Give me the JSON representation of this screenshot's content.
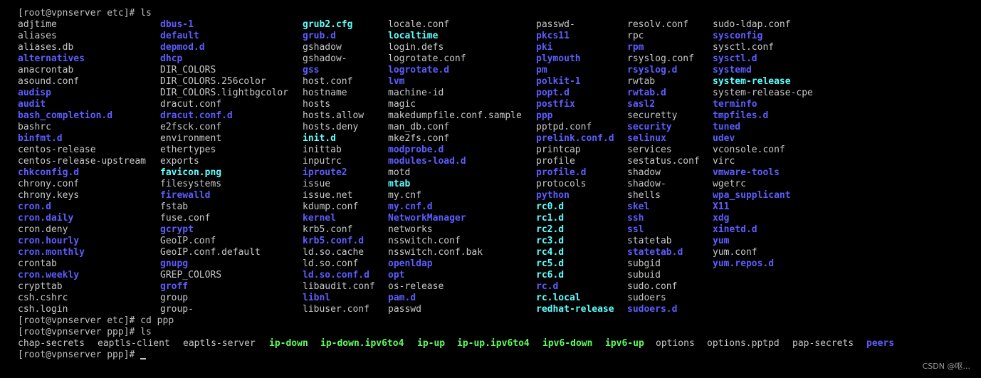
{
  "prompts": {
    "p1": "[root@vpnserver etc]# ls",
    "p2": "[root@vpnserver etc]# cd ppp",
    "p3": "[root@vpnserver ppp]# ls",
    "p4": "[root@vpnserver ppp]# "
  },
  "colors": {
    "background": "#000000",
    "file": "#c8c8c8",
    "directory": "#5d5dff",
    "symlink": "#5dffff",
    "executable": "#5dff5d"
  },
  "etc_listing": [
    [
      {
        "name": "adjtime",
        "type": "file"
      },
      {
        "name": "aliases",
        "type": "file"
      },
      {
        "name": "aliases.db",
        "type": "file"
      },
      {
        "name": "alternatives",
        "type": "dir"
      },
      {
        "name": "anacrontab",
        "type": "file"
      },
      {
        "name": "asound.conf",
        "type": "file"
      },
      {
        "name": "audisp",
        "type": "dir"
      },
      {
        "name": "audit",
        "type": "dir"
      },
      {
        "name": "bash_completion.d",
        "type": "dir"
      },
      {
        "name": "bashrc",
        "type": "file"
      },
      {
        "name": "binfmt.d",
        "type": "dir"
      },
      {
        "name": "centos-release",
        "type": "file"
      },
      {
        "name": "centos-release-upstream",
        "type": "file"
      },
      {
        "name": "chkconfig.d",
        "type": "dir"
      },
      {
        "name": "chrony.conf",
        "type": "file"
      },
      {
        "name": "chrony.keys",
        "type": "file"
      },
      {
        "name": "cron.d",
        "type": "dir"
      },
      {
        "name": "cron.daily",
        "type": "dir"
      },
      {
        "name": "cron.deny",
        "type": "file"
      },
      {
        "name": "cron.hourly",
        "type": "dir"
      },
      {
        "name": "cron.monthly",
        "type": "dir"
      },
      {
        "name": "crontab",
        "type": "file"
      },
      {
        "name": "cron.weekly",
        "type": "dir"
      },
      {
        "name": "crypttab",
        "type": "file"
      },
      {
        "name": "csh.cshrc",
        "type": "file"
      },
      {
        "name": "csh.login",
        "type": "file"
      }
    ],
    [
      {
        "name": "dbus-1",
        "type": "dir"
      },
      {
        "name": "default",
        "type": "dir"
      },
      {
        "name": "depmod.d",
        "type": "dir"
      },
      {
        "name": "dhcp",
        "type": "dir"
      },
      {
        "name": "DIR_COLORS",
        "type": "file"
      },
      {
        "name": "DIR_COLORS.256color",
        "type": "file"
      },
      {
        "name": "DIR_COLORS.lightbgcolor",
        "type": "file"
      },
      {
        "name": "dracut.conf",
        "type": "file"
      },
      {
        "name": "dracut.conf.d",
        "type": "dir"
      },
      {
        "name": "e2fsck.conf",
        "type": "file"
      },
      {
        "name": "environment",
        "type": "file"
      },
      {
        "name": "ethertypes",
        "type": "file"
      },
      {
        "name": "exports",
        "type": "file"
      },
      {
        "name": "favicon.png",
        "type": "link"
      },
      {
        "name": "filesystems",
        "type": "file"
      },
      {
        "name": "firewalld",
        "type": "dir"
      },
      {
        "name": "fstab",
        "type": "file"
      },
      {
        "name": "fuse.conf",
        "type": "file"
      },
      {
        "name": "gcrypt",
        "type": "dir"
      },
      {
        "name": "GeoIP.conf",
        "type": "file"
      },
      {
        "name": "GeoIP.conf.default",
        "type": "file"
      },
      {
        "name": "gnupg",
        "type": "dir"
      },
      {
        "name": "GREP_COLORS",
        "type": "file"
      },
      {
        "name": "groff",
        "type": "dir"
      },
      {
        "name": "group",
        "type": "file"
      },
      {
        "name": "group-",
        "type": "file"
      }
    ],
    [
      {
        "name": "grub2.cfg",
        "type": "link"
      },
      {
        "name": "grub.d",
        "type": "dir"
      },
      {
        "name": "gshadow",
        "type": "file"
      },
      {
        "name": "gshadow-",
        "type": "file"
      },
      {
        "name": "gss",
        "type": "dir"
      },
      {
        "name": "host.conf",
        "type": "file"
      },
      {
        "name": "hostname",
        "type": "file"
      },
      {
        "name": "hosts",
        "type": "file"
      },
      {
        "name": "hosts.allow",
        "type": "file"
      },
      {
        "name": "hosts.deny",
        "type": "file"
      },
      {
        "name": "init.d",
        "type": "link"
      },
      {
        "name": "inittab",
        "type": "file"
      },
      {
        "name": "inputrc",
        "type": "file"
      },
      {
        "name": "iproute2",
        "type": "dir"
      },
      {
        "name": "issue",
        "type": "file"
      },
      {
        "name": "issue.net",
        "type": "file"
      },
      {
        "name": "kdump.conf",
        "type": "file"
      },
      {
        "name": "kernel",
        "type": "dir"
      },
      {
        "name": "krb5.conf",
        "type": "file"
      },
      {
        "name": "krb5.conf.d",
        "type": "dir"
      },
      {
        "name": "ld.so.cache",
        "type": "file"
      },
      {
        "name": "ld.so.conf",
        "type": "file"
      },
      {
        "name": "ld.so.conf.d",
        "type": "dir"
      },
      {
        "name": "libaudit.conf",
        "type": "file"
      },
      {
        "name": "libnl",
        "type": "dir"
      },
      {
        "name": "libuser.conf",
        "type": "file"
      }
    ],
    [
      {
        "name": "locale.conf",
        "type": "file"
      },
      {
        "name": "localtime",
        "type": "link"
      },
      {
        "name": "login.defs",
        "type": "file"
      },
      {
        "name": "logrotate.conf",
        "type": "file"
      },
      {
        "name": "logrotate.d",
        "type": "dir"
      },
      {
        "name": "lvm",
        "type": "dir"
      },
      {
        "name": "machine-id",
        "type": "file"
      },
      {
        "name": "magic",
        "type": "file"
      },
      {
        "name": "makedumpfile.conf.sample",
        "type": "file"
      },
      {
        "name": "man_db.conf",
        "type": "file"
      },
      {
        "name": "mke2fs.conf",
        "type": "file"
      },
      {
        "name": "modprobe.d",
        "type": "dir"
      },
      {
        "name": "modules-load.d",
        "type": "dir"
      },
      {
        "name": "motd",
        "type": "file"
      },
      {
        "name": "mtab",
        "type": "link"
      },
      {
        "name": "my.cnf",
        "type": "file"
      },
      {
        "name": "my.cnf.d",
        "type": "dir"
      },
      {
        "name": "NetworkManager",
        "type": "dir"
      },
      {
        "name": "networks",
        "type": "file"
      },
      {
        "name": "nsswitch.conf",
        "type": "file"
      },
      {
        "name": "nsswitch.conf.bak",
        "type": "file"
      },
      {
        "name": "openldap",
        "type": "dir"
      },
      {
        "name": "opt",
        "type": "dir"
      },
      {
        "name": "os-release",
        "type": "file"
      },
      {
        "name": "pam.d",
        "type": "dir"
      },
      {
        "name": "passwd",
        "type": "file"
      }
    ],
    [
      {
        "name": "passwd-",
        "type": "file"
      },
      {
        "name": "pkcs11",
        "type": "dir"
      },
      {
        "name": "pki",
        "type": "dir"
      },
      {
        "name": "plymouth",
        "type": "dir"
      },
      {
        "name": "pm",
        "type": "dir"
      },
      {
        "name": "polkit-1",
        "type": "dir"
      },
      {
        "name": "popt.d",
        "type": "dir"
      },
      {
        "name": "postfix",
        "type": "dir"
      },
      {
        "name": "ppp",
        "type": "dir"
      },
      {
        "name": "pptpd.conf",
        "type": "file"
      },
      {
        "name": "prelink.conf.d",
        "type": "dir"
      },
      {
        "name": "printcap",
        "type": "file"
      },
      {
        "name": "profile",
        "type": "file"
      },
      {
        "name": "profile.d",
        "type": "dir"
      },
      {
        "name": "protocols",
        "type": "file"
      },
      {
        "name": "python",
        "type": "dir"
      },
      {
        "name": "rc0.d",
        "type": "link"
      },
      {
        "name": "rc1.d",
        "type": "link"
      },
      {
        "name": "rc2.d",
        "type": "link"
      },
      {
        "name": "rc3.d",
        "type": "link"
      },
      {
        "name": "rc4.d",
        "type": "link"
      },
      {
        "name": "rc5.d",
        "type": "link"
      },
      {
        "name": "rc6.d",
        "type": "link"
      },
      {
        "name": "rc.d",
        "type": "dir"
      },
      {
        "name": "rc.local",
        "type": "link"
      },
      {
        "name": "redhat-release",
        "type": "link"
      }
    ],
    [
      {
        "name": "resolv.conf",
        "type": "file"
      },
      {
        "name": "rpc",
        "type": "file"
      },
      {
        "name": "rpm",
        "type": "dir"
      },
      {
        "name": "rsyslog.conf",
        "type": "file"
      },
      {
        "name": "rsyslog.d",
        "type": "dir"
      },
      {
        "name": "rwtab",
        "type": "file"
      },
      {
        "name": "rwtab.d",
        "type": "dir"
      },
      {
        "name": "sasl2",
        "type": "dir"
      },
      {
        "name": "securetty",
        "type": "file"
      },
      {
        "name": "security",
        "type": "dir"
      },
      {
        "name": "selinux",
        "type": "dir"
      },
      {
        "name": "services",
        "type": "file"
      },
      {
        "name": "sestatus.conf",
        "type": "file"
      },
      {
        "name": "shadow",
        "type": "file"
      },
      {
        "name": "shadow-",
        "type": "file"
      },
      {
        "name": "shells",
        "type": "file"
      },
      {
        "name": "skel",
        "type": "dir"
      },
      {
        "name": "ssh",
        "type": "dir"
      },
      {
        "name": "ssl",
        "type": "dir"
      },
      {
        "name": "statetab",
        "type": "file"
      },
      {
        "name": "statetab.d",
        "type": "dir"
      },
      {
        "name": "subgid",
        "type": "file"
      },
      {
        "name": "subuid",
        "type": "file"
      },
      {
        "name": "sudo.conf",
        "type": "file"
      },
      {
        "name": "sudoers",
        "type": "file"
      },
      {
        "name": "sudoers.d",
        "type": "dir"
      }
    ],
    [
      {
        "name": "sudo-ldap.conf",
        "type": "file"
      },
      {
        "name": "sysconfig",
        "type": "dir"
      },
      {
        "name": "sysctl.conf",
        "type": "file"
      },
      {
        "name": "sysctl.d",
        "type": "dir"
      },
      {
        "name": "systemd",
        "type": "dir"
      },
      {
        "name": "system-release",
        "type": "link"
      },
      {
        "name": "system-release-cpe",
        "type": "file"
      },
      {
        "name": "terminfo",
        "type": "dir"
      },
      {
        "name": "tmpfiles.d",
        "type": "dir"
      },
      {
        "name": "tuned",
        "type": "dir"
      },
      {
        "name": "udev",
        "type": "dir"
      },
      {
        "name": "vconsole.conf",
        "type": "file"
      },
      {
        "name": "virc",
        "type": "file"
      },
      {
        "name": "vmware-tools",
        "type": "dir"
      },
      {
        "name": "wgetrc",
        "type": "file"
      },
      {
        "name": "wpa_supplicant",
        "type": "dir"
      },
      {
        "name": "X11",
        "type": "dir"
      },
      {
        "name": "xdg",
        "type": "dir"
      },
      {
        "name": "xinetd.d",
        "type": "dir"
      },
      {
        "name": "yum",
        "type": "dir"
      },
      {
        "name": "yum.conf",
        "type": "file"
      },
      {
        "name": "yum.repos.d",
        "type": "dir"
      }
    ]
  ],
  "ppp_listing": [
    {
      "name": "chap-secrets",
      "type": "file"
    },
    {
      "name": "eaptls-client",
      "type": "file"
    },
    {
      "name": "eaptls-server",
      "type": "file"
    },
    {
      "name": "ip-down",
      "type": "exec"
    },
    {
      "name": "ip-down.ipv6to4",
      "type": "exec"
    },
    {
      "name": "ip-up",
      "type": "exec"
    },
    {
      "name": "ip-up.ipv6to4",
      "type": "exec"
    },
    {
      "name": "ipv6-down",
      "type": "exec"
    },
    {
      "name": "ipv6-up",
      "type": "exec"
    },
    {
      "name": "options",
      "type": "file"
    },
    {
      "name": "options.pptpd",
      "type": "file"
    },
    {
      "name": "pap-secrets",
      "type": "file"
    },
    {
      "name": "peers",
      "type": "dir"
    }
  ],
  "watermark": "CSDN @呕..."
}
